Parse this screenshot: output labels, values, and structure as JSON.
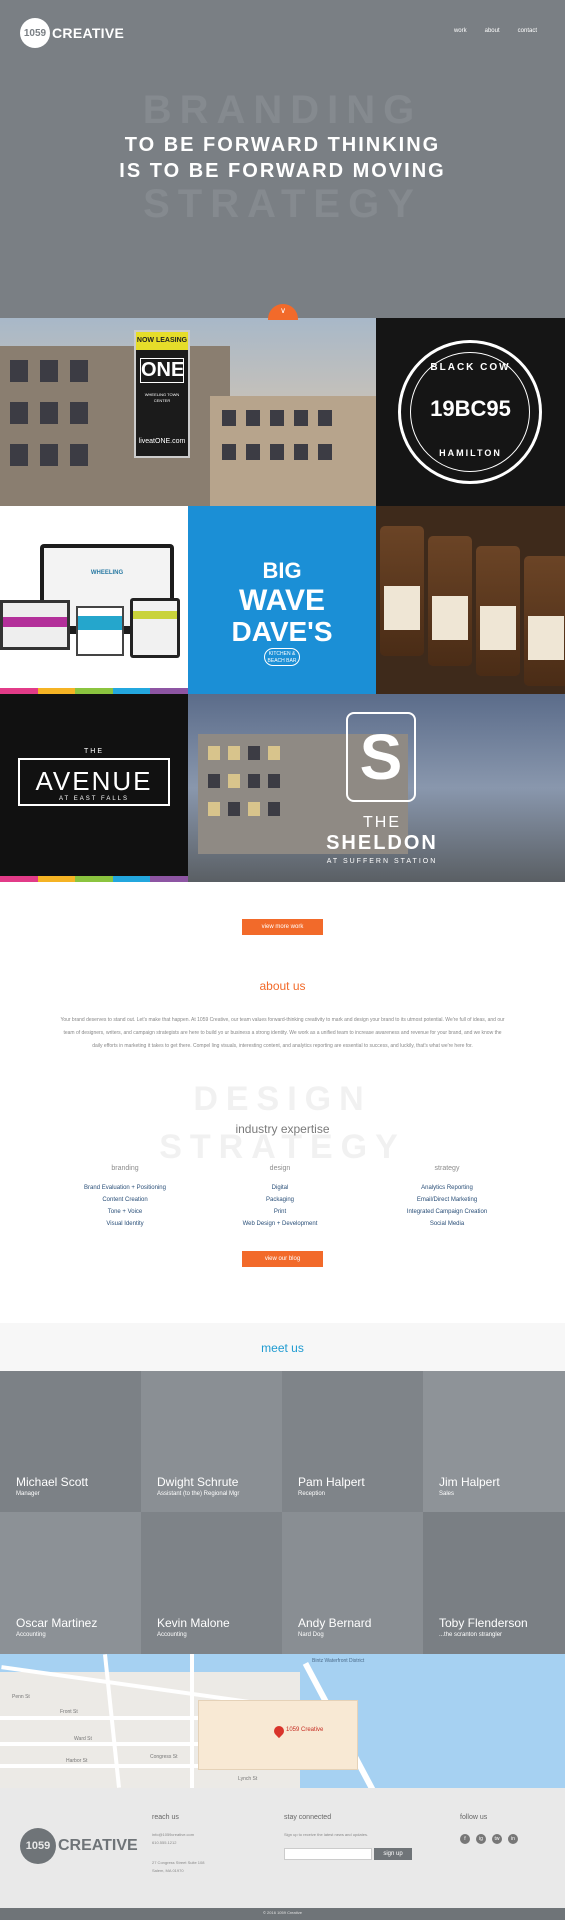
{
  "brand": {
    "logo_number": "1059",
    "logo_word": "CREATIVE"
  },
  "nav": {
    "work": "work",
    "about": "about",
    "contact": "contact"
  },
  "hero": {
    "ghost_top": "BRANDING",
    "ghost_bottom": "STRATEGY",
    "tagline_line1": "TO BE FORWARD THINKING",
    "tagline_line2": "IS TO BE FORWARD MOVING",
    "scroll_icon": "chevron-down-icon"
  },
  "portfolio": {
    "one": {
      "banner": "NOW LEASING",
      "name": "ONE",
      "sub": "WHEELING TOWN CENTER",
      "url": "liveatONE.com"
    },
    "black_cow": {
      "top": "BLACK COW",
      "mid_left": "B",
      "year_left": "19",
      "mid_right": "C",
      "year_right": "95",
      "bottom": "HAMILTON"
    },
    "wheeling": {
      "logo": "WHEELING"
    },
    "big_wave": {
      "l1": "BIG",
      "l2": "WAVE",
      "l3": "DAVE'S",
      "badge": "KITCHEN & BEACH BAR"
    },
    "avenue": {
      "the": "THE",
      "name": "AVENUE",
      "sub": "AT EAST FALLS"
    },
    "sheldon": {
      "monogram": "S",
      "the": "THE",
      "name": "SHELDON",
      "sub": "AT SUFFERN STATION"
    },
    "stripe_colors": [
      "#e23b88",
      "#f5b324",
      "#8bc43f",
      "#23a7de",
      "#8d55a3"
    ]
  },
  "buttons": {
    "view_more": "view more work",
    "view_blog": "view our blog"
  },
  "about": {
    "title": "about us",
    "body": "Your brand deserves to stand out. Let's make that happen. At 1059 Creative, our team values forward-thinking creativity to mark and design your brand to its utmost potential. We're full of ideas, and our team of designers, writers, and campaign strategists are here to build yo ur business a strong identity. We work as a unified team to increase awareness and revenue for your brand, and we know the daily efforts in marketing it takes to get there. Compel ling visuals, interesting content, and analytics reporting are essential to success, and luckily, that's what we're here for."
  },
  "expertise": {
    "ghost_design": "DESIGN",
    "ghost_strategy": "STRATEGY",
    "title": "industry expertise",
    "columns": [
      {
        "heading": "branding",
        "items": [
          "Brand Evaluation + Positioning",
          "Content Creation",
          "Tone + Voice",
          "Visual Identity"
        ]
      },
      {
        "heading": "design",
        "items": [
          "Digital",
          "Packaging",
          "Print",
          "Web Design + Development"
        ]
      },
      {
        "heading": "strategy",
        "items": [
          "Analytics Reporting",
          "Email/Direct Marketing",
          "Integrated Campaign Creation",
          "Social Media"
        ]
      }
    ]
  },
  "team": {
    "title": "meet us",
    "members": [
      {
        "name": "Michael Scott",
        "role": "Manager",
        "color": "#7c8186"
      },
      {
        "name": "Dwight Schrute",
        "role": "Assistant (to the) Regional Mgr",
        "color": "#8a8f94"
      },
      {
        "name": "Pam Halpert",
        "role": "Reception",
        "color": "#7f8489"
      },
      {
        "name": "Jim Halpert",
        "role": "Sales",
        "color": "#8e9398"
      },
      {
        "name": "Oscar Martinez",
        "role": "Accounting",
        "color": "#8c9196"
      },
      {
        "name": "Kevin Malone",
        "role": "Accounting",
        "color": "#7e8388"
      },
      {
        "name": "Andy Bernard",
        "role": "Nard Dog",
        "color": "#898e93"
      },
      {
        "name": "Toby Flenderson",
        "role": "...the scranton strangler",
        "color": "#7a7f84"
      }
    ]
  },
  "map": {
    "pin_label": "1059 Creative",
    "streets": [
      "Penn St",
      "Front St",
      "Ward St",
      "Harbor St",
      "Lynch St",
      "Congress St",
      "Bintz Waterfront District"
    ]
  },
  "footer": {
    "reach_title": "reach us",
    "email": "info@1059creative.com",
    "phone": "610.555.1212",
    "address1": "27 Congress Street Suite 108",
    "address2": "Salem, MA 01970",
    "connect_title": "stay connected",
    "connect_text": "Sign up to receive the latest news and updates.",
    "signup": "sign up",
    "follow_title": "follow us",
    "social": [
      "f",
      "ig",
      "tw",
      "in"
    ],
    "copyright": "© 2016 1059 Creative"
  }
}
